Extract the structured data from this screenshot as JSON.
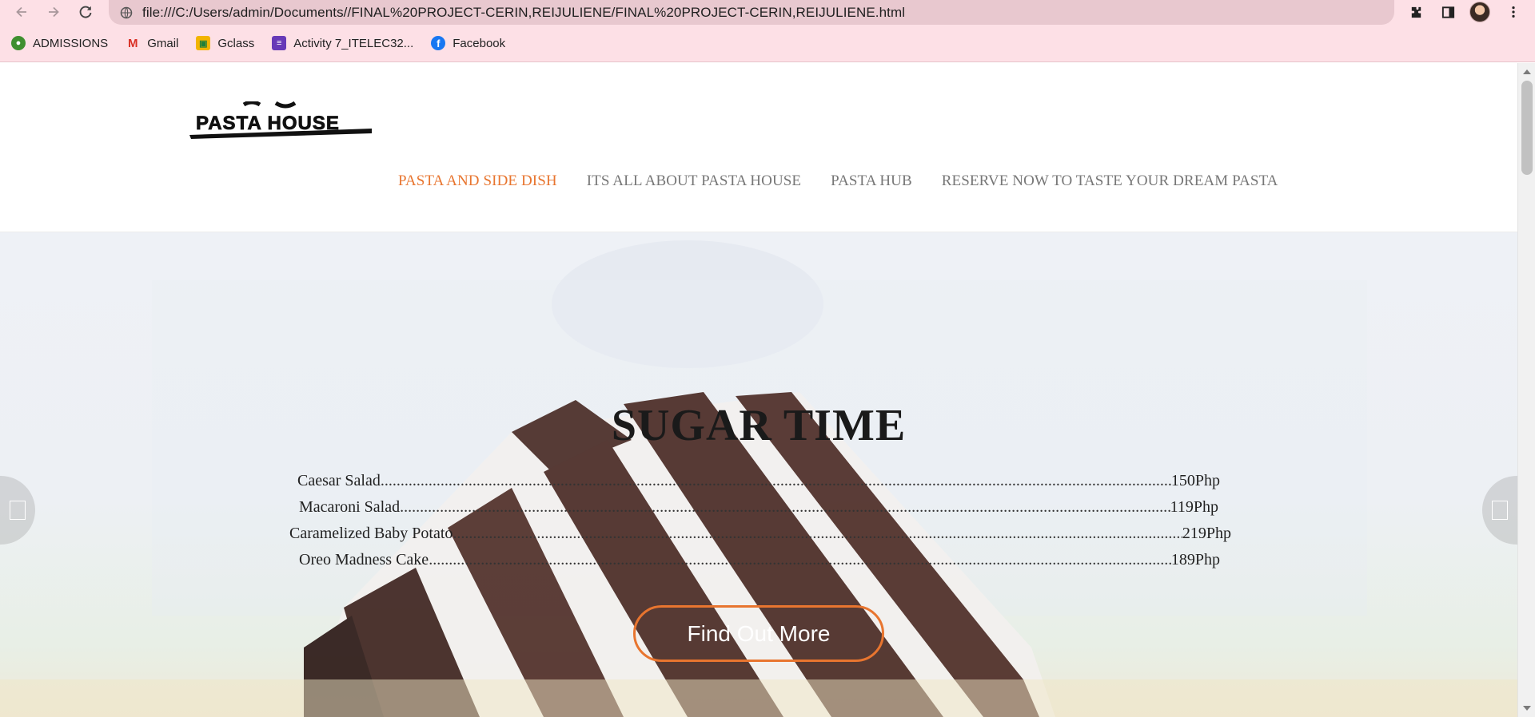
{
  "browser": {
    "url": "file:///C:/Users/admin/Documents//FINAL%20PROJECT-CERIN,REIJULIENE/FINAL%20PROJECT-CERIN,REIJULIENE.html",
    "bookmarks": [
      {
        "label": "ADMISSIONS",
        "icon": "admissions-icon",
        "color": "#3f8f2f"
      },
      {
        "label": "Gmail",
        "icon": "gmail-icon",
        "color": "#d93025"
      },
      {
        "label": "Gclass",
        "icon": "google-classroom-icon",
        "color": "#f2b400"
      },
      {
        "label": "Activity 7_ITELEC32...",
        "icon": "forms-icon",
        "color": "#673ab7"
      },
      {
        "label": "Facebook",
        "icon": "facebook-icon",
        "color": "#1877f2"
      }
    ]
  },
  "site": {
    "logo_text": "PASTA HOUSE",
    "nav": [
      {
        "label": "PASTA AND SIDE DISH",
        "active": true
      },
      {
        "label": "ITS ALL ABOUT PASTA HOUSE",
        "active": false
      },
      {
        "label": "PASTA HUB",
        "active": false
      },
      {
        "label": "RESERVE NOW TO TASTE YOUR DREAM PASTA",
        "active": false
      }
    ],
    "accent_color": "#e8752f"
  },
  "hero": {
    "title": "SUGAR TIME",
    "menu": [
      {
        "name": "Caesar Salad",
        "price": "150Php"
      },
      {
        "name": "Macaroni Salad",
        "price": "119Php"
      },
      {
        "name": "Caramelized Baby Potato",
        "price": "219Php"
      },
      {
        "name": "Oreo Madness Cake",
        "price": "189Php"
      }
    ],
    "cta_label": "Find Out More"
  }
}
